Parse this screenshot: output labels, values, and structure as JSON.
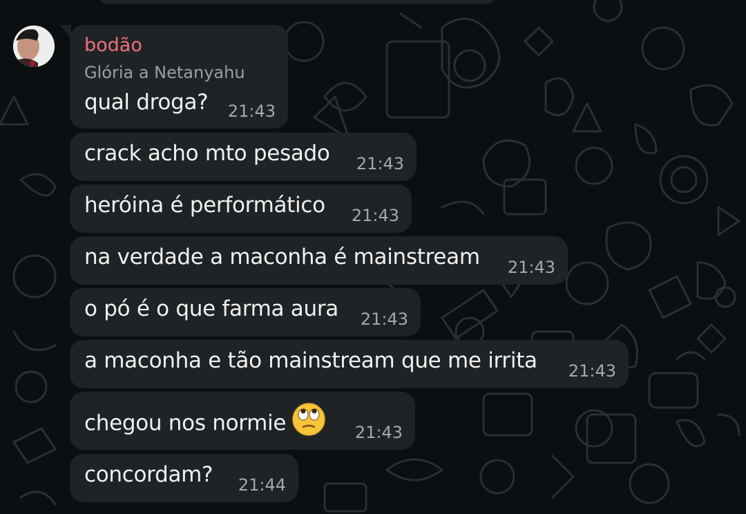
{
  "chat": {
    "sender_name": "bodão",
    "sender_subtitle": "Glória a Netanyahu",
    "messages": [
      {
        "text": "qual droga?",
        "time": "21:43"
      },
      {
        "text": "crack acho mto pesado",
        "time": "21:43"
      },
      {
        "text": "heróina é performático",
        "time": "21:43"
      },
      {
        "text": "na verdade a maconha é mainstream",
        "time": "21:43"
      },
      {
        "text": "o pó é o que farma aura",
        "time": "21:43"
      },
      {
        "text": "a maconha e tão mainstream que me irrita",
        "time": "21:43"
      },
      {
        "text": "chegou nos normie",
        "time": "21:43",
        "emoji": "face-with-rolling-eyes"
      },
      {
        "text": "concordam?",
        "time": "21:44"
      }
    ]
  },
  "colors": {
    "background": "#0b0f11",
    "bubble": "#1f2326",
    "sender_name": "#f0707c",
    "timestamp": "#a5a9ab"
  }
}
